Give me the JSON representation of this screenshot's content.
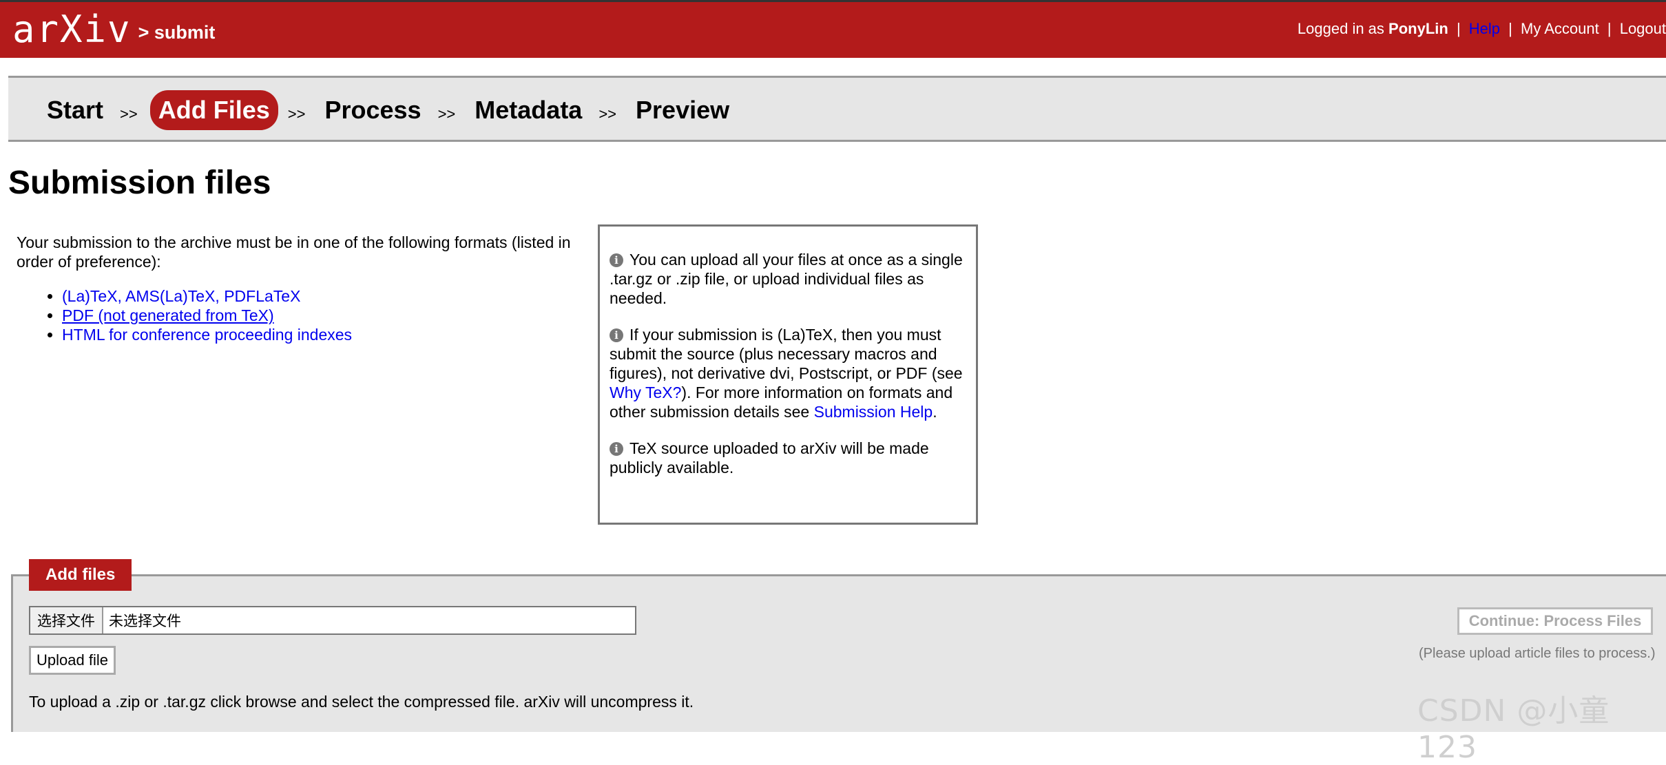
{
  "header": {
    "logo_text": "arXiv",
    "crumb": "> submit",
    "logged_in_prefix": "Logged in as",
    "username": "PonyLin",
    "links": [
      "Help",
      "My Account",
      "Logout"
    ]
  },
  "steps": [
    {
      "label": "Start",
      "active": false
    },
    {
      "label": "Add Files",
      "active": true
    },
    {
      "label": "Process",
      "active": false
    },
    {
      "label": "Metadata",
      "active": false
    },
    {
      "label": "Preview",
      "active": false
    }
  ],
  "step_separator": ">>",
  "page_title": "Submission files",
  "intro": {
    "text": "Your submission to the archive must be in one of the following formats (listed in order of preference):",
    "formats": [
      "(La)TeX, AMS(La)TeX, PDFLaTeX",
      "PDF (not generated from TeX)",
      "HTML for conference proceeding indexes"
    ]
  },
  "infobox": {
    "p1": "You can upload all your files at once as a single .tar.gz or .zip file, or upload individual files as needed.",
    "p2_before": "If your submission is (La)TeX, then you must submit the source (plus necessary macros and figures), not derivative dvi, Postscript, or PDF (see ",
    "p2_link1": "Why TeX?",
    "p2_middle": "). For more information on formats and other submission details see ",
    "p2_link2": "Submission Help",
    "p2_after": ".",
    "p3": "TeX source uploaded to arXiv will be made publicly available."
  },
  "add_files": {
    "legend": "Add files",
    "choose_label": "选择文件",
    "no_file_label": "未选择文件",
    "upload_label": "Upload file",
    "hint": "To upload a .zip or .tar.gz click browse and select the compressed file. arXiv will uncompress it.",
    "continue_label": "Continue: Process Files",
    "continue_note": "(Please upload article files to process.)"
  },
  "watermark": "CSDN @小童123",
  "colors": {
    "brand": "#b31b1b",
    "link": "#0000ee",
    "panel": "#e6e6e6"
  }
}
